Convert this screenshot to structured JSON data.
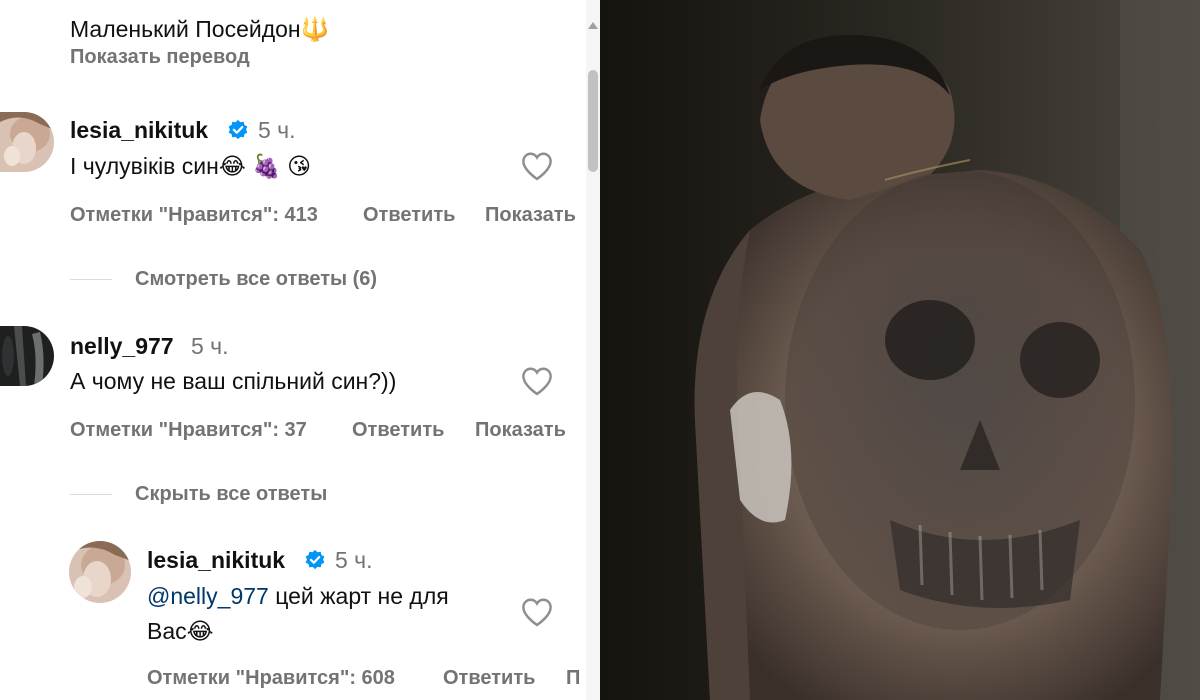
{
  "post_caption": {
    "text": "Маленький Посейдон",
    "emoji": "🔱",
    "translate_label": "Показать перевод"
  },
  "comments": [
    {
      "username": "lesia_nikituk",
      "verified": true,
      "time": "5 ч.",
      "text": "І чулувіків син",
      "emojis": "😂 🍇 😘",
      "likes_label": "Отметки \"Нравится\": 413",
      "reply_label": "Ответить",
      "more_label": "Показать",
      "view_replies_label": "Смотреть все ответы (6)"
    },
    {
      "username": "nelly_977",
      "verified": false,
      "time": "5 ч.",
      "text": "А чому не ваш спільний син?))",
      "likes_label": "Отметки \"Нравится\": 37",
      "reply_label": "Ответить",
      "more_label": "Показать",
      "hide_replies_label": "Скрыть все ответы"
    }
  ],
  "reply": {
    "username": "lesia_nikituk",
    "verified": true,
    "time": "5 ч.",
    "mention": "@nelly_977",
    "text_line1": "цей жарт не для",
    "text_line2": "Вас",
    "emoji": "😂",
    "likes_label": "Отметки \"Нравится\": 608",
    "reply_label": "Ответить",
    "more_label": "П"
  },
  "colors": {
    "verified": "#0095f6",
    "meta": "#737373",
    "mention": "#00376b"
  }
}
